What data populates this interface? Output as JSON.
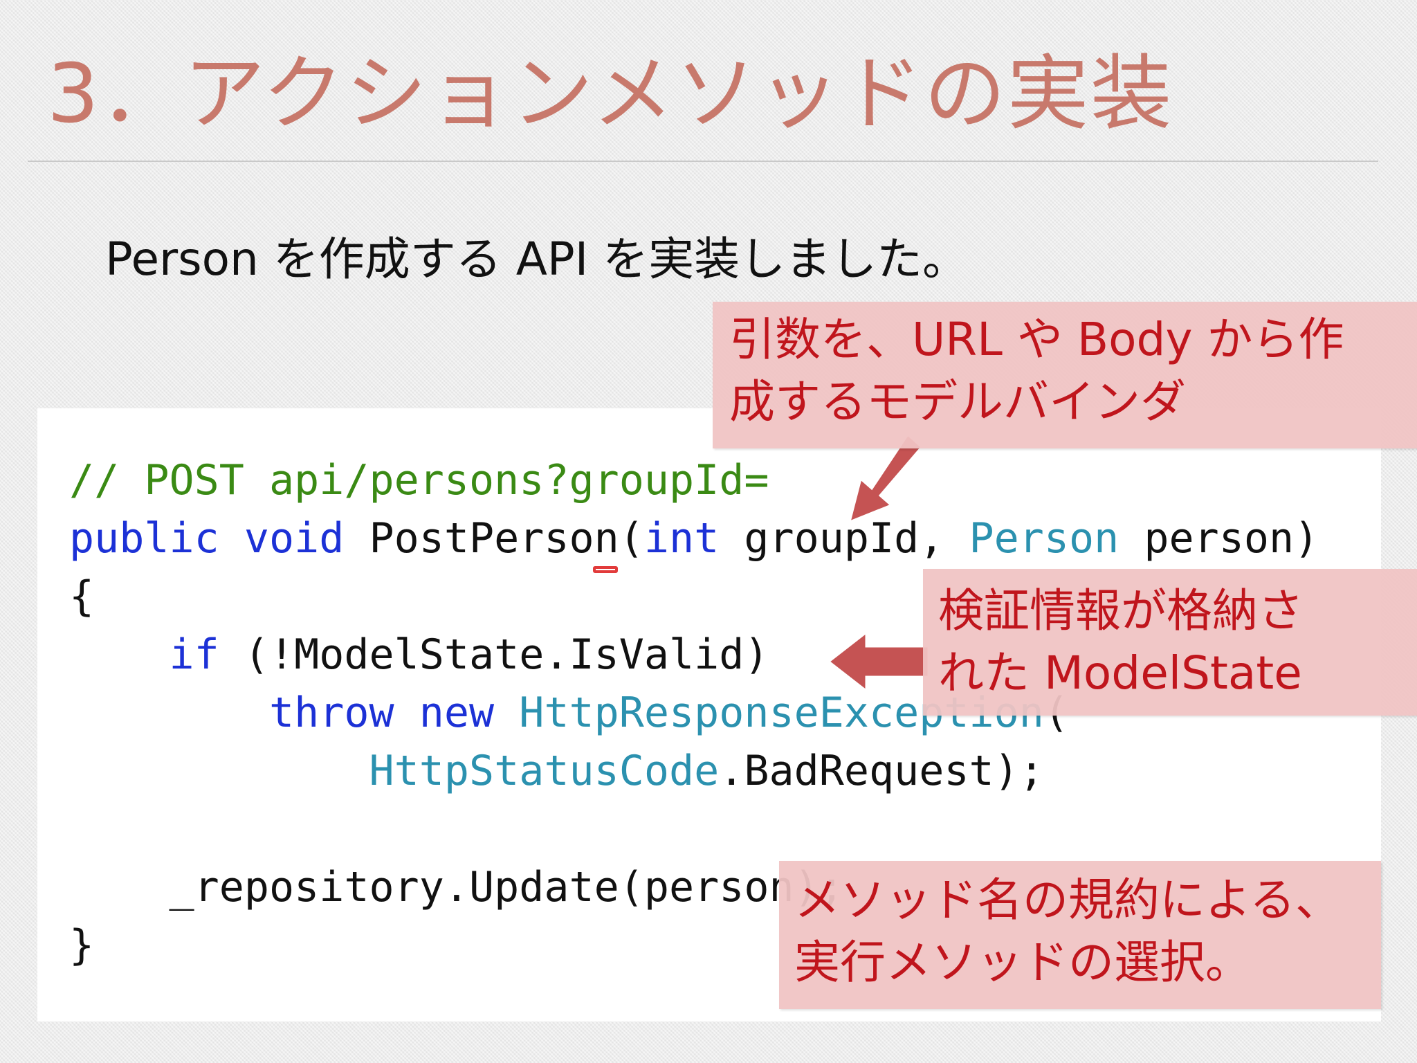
{
  "slide": {
    "title": "3．アクションメソッドの実装",
    "subtitle": "Person を作成する API を実装しました。"
  },
  "code": {
    "lines": [
      [
        {
          "t": "// POST api/persons?groupId=",
          "c": "cmt"
        }
      ],
      [
        {
          "t": "public",
          "c": "kw"
        },
        {
          "t": " "
        },
        {
          "t": "void",
          "c": "kw"
        },
        {
          "t": " PostPerson("
        },
        {
          "t": "int",
          "c": "kw"
        },
        {
          "t": " groupId, "
        },
        {
          "t": "Person",
          "c": "ty"
        },
        {
          "t": " person)"
        }
      ],
      [
        {
          "t": "{"
        }
      ],
      [
        {
          "t": "    "
        },
        {
          "t": "if",
          "c": "kw"
        },
        {
          "t": " (!ModelState.IsValid)"
        }
      ],
      [
        {
          "t": "        "
        },
        {
          "t": "throw",
          "c": "kw"
        },
        {
          "t": " "
        },
        {
          "t": "new",
          "c": "kw"
        },
        {
          "t": " "
        },
        {
          "t": "HttpResponseException",
          "c": "ty"
        },
        {
          "t": "("
        }
      ],
      [
        {
          "t": "            "
        },
        {
          "t": "HttpStatusCode",
          "c": "ty"
        },
        {
          "t": ".BadRequest);"
        }
      ],
      [
        {
          "t": ""
        }
      ],
      [
        {
          "t": "    _repository.Update(person);"
        }
      ],
      [
        {
          "t": "}"
        }
      ]
    ]
  },
  "callouts": {
    "model_binder": [
      "引数を、URL や Body から作",
      "成するモデルバインダ"
    ],
    "model_state": [
      "検証情報が格納さ",
      "れた ModelState"
    ],
    "method_selection": [
      "メソッド名の規約による、",
      "実行メソッドの選択。"
    ]
  },
  "colors": {
    "title": "#c8796c",
    "comment": "#3a8a14",
    "keyword": "#1c31d6",
    "type": "#2b91af",
    "callout_bg": "#f0c4c4",
    "callout_text": "#c0151c",
    "arrow": "#c24a4a"
  }
}
